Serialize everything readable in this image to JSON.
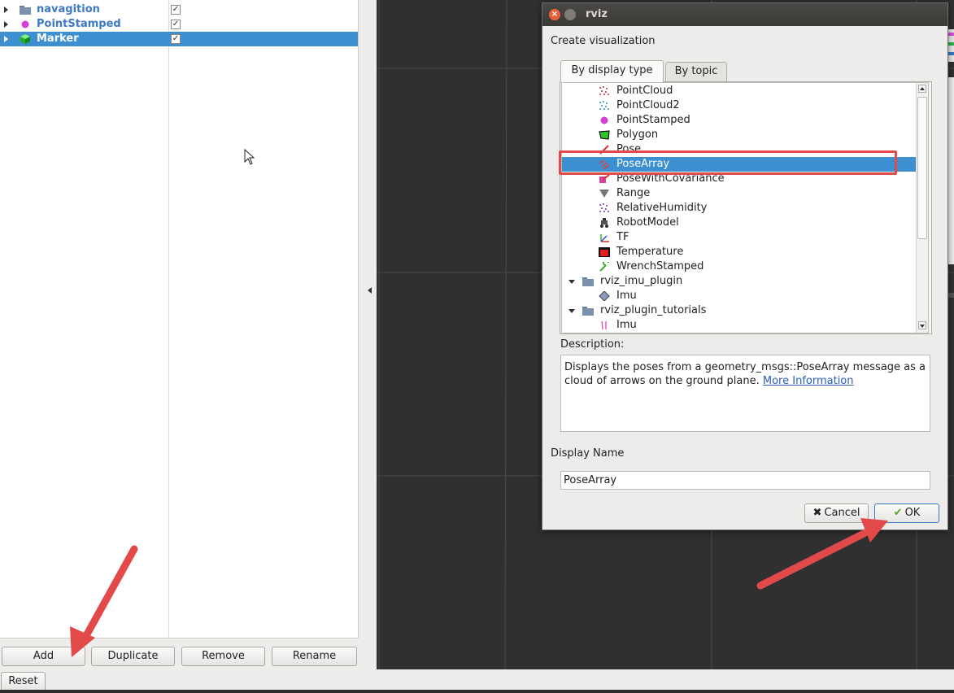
{
  "displays_panel": {
    "items": [
      {
        "name": "navagition",
        "icon": "folder-icon",
        "checked": true
      },
      {
        "name": "PointStamped",
        "icon": "point-icon",
        "checked": true
      },
      {
        "name": "Marker",
        "icon": "marker-cube-icon",
        "checked": true,
        "selected": true
      }
    ],
    "buttons": {
      "add": "Add",
      "duplicate": "Duplicate",
      "remove": "Remove",
      "rename": "Rename",
      "reset": "Reset"
    }
  },
  "dialog": {
    "title": "rviz",
    "heading": "Create visualization",
    "tabs": [
      "By display type",
      "By topic"
    ],
    "active_tab": "By display type",
    "tree": [
      {
        "label": "PointCloud",
        "icon": "pointcloud-icon"
      },
      {
        "label": "PointCloud2",
        "icon": "pointcloud2-icon"
      },
      {
        "label": "PointStamped",
        "icon": "point-icon"
      },
      {
        "label": "Polygon",
        "icon": "polygon-icon"
      },
      {
        "label": "Pose",
        "icon": "pose-arrow-icon"
      },
      {
        "label": "PoseArray",
        "icon": "posearray-icon",
        "selected": true
      },
      {
        "label": "PoseWithCovariance",
        "icon": "pose-covariance-icon"
      },
      {
        "label": "Range",
        "icon": "range-icon"
      },
      {
        "label": "RelativeHumidity",
        "icon": "humidity-icon"
      },
      {
        "label": "RobotModel",
        "icon": "robot-icon"
      },
      {
        "label": "TF",
        "icon": "tf-axes-icon"
      },
      {
        "label": "Temperature",
        "icon": "temperature-icon"
      },
      {
        "label": "WrenchStamped",
        "icon": "wrench-icon"
      },
      {
        "label": "rviz_imu_plugin",
        "icon": "folder-icon",
        "group": true
      },
      {
        "label": "Imu",
        "icon": "imu-diamond-icon"
      },
      {
        "label": "rviz_plugin_tutorials",
        "icon": "folder-icon",
        "group": true
      },
      {
        "label": "Imu",
        "icon": "imu-bars-icon"
      }
    ],
    "description_label": "Description:",
    "description_text": "Displays the poses from a geometry_msgs::PoseArray message as a cloud of arrows on the ground plane. ",
    "description_link": "More Information",
    "display_name_label": "Display Name",
    "display_name_value": "PoseArray",
    "cancel_label": "Cancel",
    "ok_label": "OK"
  },
  "colors": {
    "selection": "#3c8fd1",
    "annotation_red": "#e24a4a",
    "viewport_bg": "#303030"
  }
}
